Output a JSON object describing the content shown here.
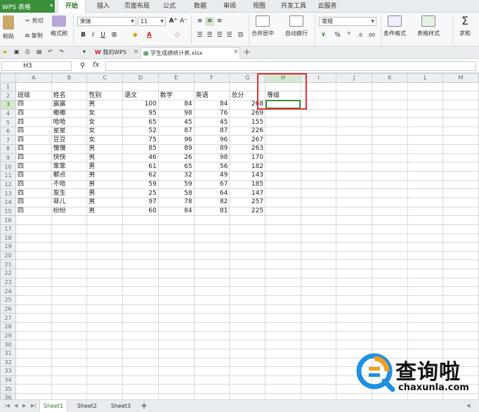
{
  "app": {
    "name": "WPS 表格"
  },
  "menu_tabs": [
    "开始",
    "插入",
    "页面布局",
    "公式",
    "数据",
    "审阅",
    "视图",
    "开发工具",
    "云服务"
  ],
  "ribbon": {
    "paste": "粘贴",
    "cut": "剪切",
    "copy": "复制",
    "format_painter": "格式刷",
    "font_name": "宋体",
    "font_size": "11",
    "merge_center": "合并居中",
    "wrap_text": "自动换行",
    "number_format": "常规",
    "conditional_format": "条件格式",
    "table_style": "表格样式",
    "sum": "求和"
  },
  "doc_tabs": [
    {
      "label": "我的WPS"
    },
    {
      "label": "学生成绩统计表.xlsx"
    }
  ],
  "formula_bar": {
    "name_box": "H3",
    "fx": "fx",
    "value": ""
  },
  "columns": [
    "A",
    "B",
    "C",
    "D",
    "E",
    "F",
    "G",
    "H",
    "I",
    "J",
    "K",
    "L",
    "M"
  ],
  "row_numbers": [
    "1",
    "2",
    "3",
    "4",
    "5",
    "6",
    "7",
    "8",
    "9",
    "10",
    "11",
    "12",
    "13",
    "14",
    "15",
    "16",
    "17",
    "18",
    "19",
    "20",
    "21",
    "22",
    "23",
    "24",
    "25",
    "26",
    "27",
    "28",
    "29",
    "30",
    "31",
    "32",
    "33",
    "34",
    "35",
    "36"
  ],
  "headers": [
    "班级",
    "姓名",
    "性别",
    "语文",
    "数学",
    "英语",
    "总分",
    "等级"
  ],
  "rows": [
    [
      "四",
      "露露",
      "男",
      "100",
      "84",
      "84",
      "268"
    ],
    [
      "四",
      "鄉鄉",
      "女",
      "95",
      "98",
      "76",
      "269"
    ],
    [
      "四",
      "哈哈",
      "女",
      "65",
      "45",
      "45",
      "155"
    ],
    [
      "四",
      "星星",
      "女",
      "52",
      "87",
      "87",
      "226"
    ],
    [
      "四",
      "豆豆",
      "女",
      "75",
      "96",
      "96",
      "267"
    ],
    [
      "四",
      "慢慢",
      "男",
      "85",
      "89",
      "89",
      "263"
    ],
    [
      "四",
      "快快",
      "男",
      "46",
      "26",
      "98",
      "170"
    ],
    [
      "四",
      "笨笨",
      "男",
      "61",
      "65",
      "56",
      "182"
    ],
    [
      "四",
      "都点",
      "男",
      "62",
      "32",
      "49",
      "143"
    ],
    [
      "四",
      "不哈",
      "男",
      "59",
      "59",
      "67",
      "185"
    ],
    [
      "四",
      "发生",
      "男",
      "25",
      "58",
      "64",
      "147"
    ],
    [
      "四",
      "菲儿",
      "男",
      "97",
      "78",
      "82",
      "257"
    ],
    [
      "四",
      "纷纷",
      "男",
      "60",
      "84",
      "81",
      "225"
    ]
  ],
  "selected_cell": "H3",
  "sheets": [
    "Sheet1",
    "Sheet2",
    "Sheet3"
  ],
  "add_sheet": "+",
  "watermark": {
    "text": "查询啦",
    "url": "chaxunla.com"
  },
  "colors": {
    "accent": "#3a8f3a",
    "highlight_box": "#e0302c"
  }
}
